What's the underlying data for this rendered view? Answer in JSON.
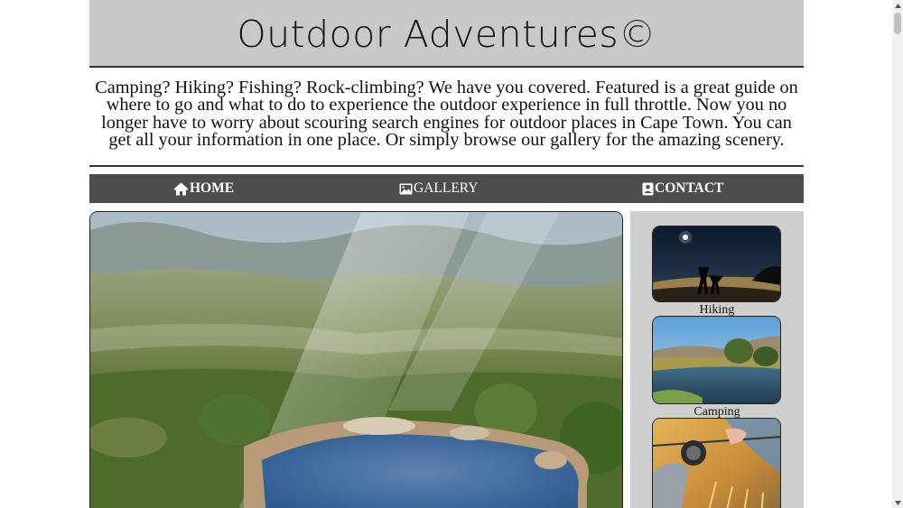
{
  "header": {
    "title": "Outdoor Adventures©"
  },
  "intro": {
    "text": "Camping? Hiking? Fishing? Rock-climbing? We have you covered. Featured is a great guide on where to go and what to do to experience the outdoor experience in full throttle. Now you no longer have to worry about scouring search engines for outdoor places in Cape Town. You can get all your information in one place. Or simply browse our gallery for the amazing scenery."
  },
  "nav": {
    "home_label": "HOME",
    "gallery_label": "GALLERY",
    "contact_label": "CONTACT",
    "home_icon": "home-icon",
    "gallery_icon": "image-icon",
    "contact_icon": "contact-card-icon"
  },
  "sidebar": {
    "items": [
      {
        "caption": "Hiking"
      },
      {
        "caption": "Camping"
      },
      {
        "caption": ""
      }
    ]
  },
  "colors": {
    "header_bg": "#c9c9c9",
    "nav_bg": "#4d4d4d",
    "sidebar_bg": "#cfcfcf"
  }
}
